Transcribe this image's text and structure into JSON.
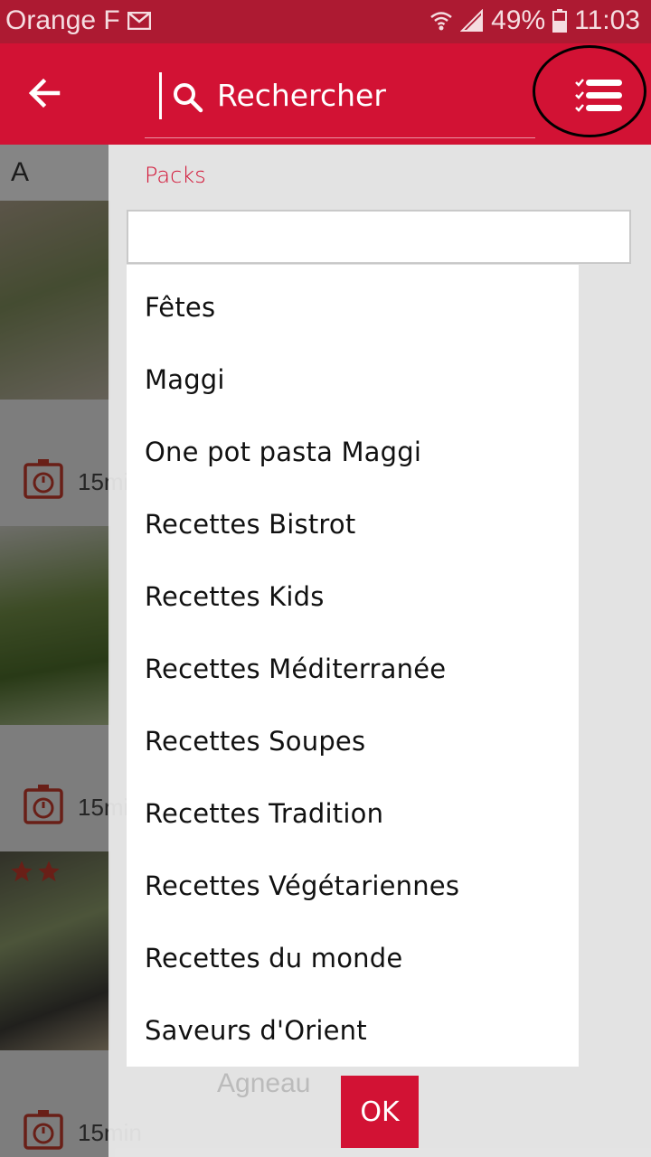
{
  "status_bar": {
    "carrier": "Orange F",
    "battery": "49%",
    "time": "11:03"
  },
  "header": {
    "search_label": "Rechercher",
    "colors": {
      "bar": "#d21234",
      "status": "#ad1a32"
    }
  },
  "background": {
    "section_letter": "A",
    "timer_1": "15min",
    "timer_2": "15min",
    "timer_3": "15min",
    "card_title": "Agneau"
  },
  "drawer": {
    "title": "Packs",
    "filter_placeholder": "",
    "packs": [
      "Fêtes",
      "Maggi",
      "One pot pasta Maggi",
      "Recettes Bistrot",
      "Recettes Kids",
      "Recettes Méditerranée",
      "Recettes Soupes",
      "Recettes Tradition",
      "Recettes Végétariennes",
      "Recettes du monde",
      "Saveurs d'Orient"
    ],
    "ok_label": "OK"
  }
}
